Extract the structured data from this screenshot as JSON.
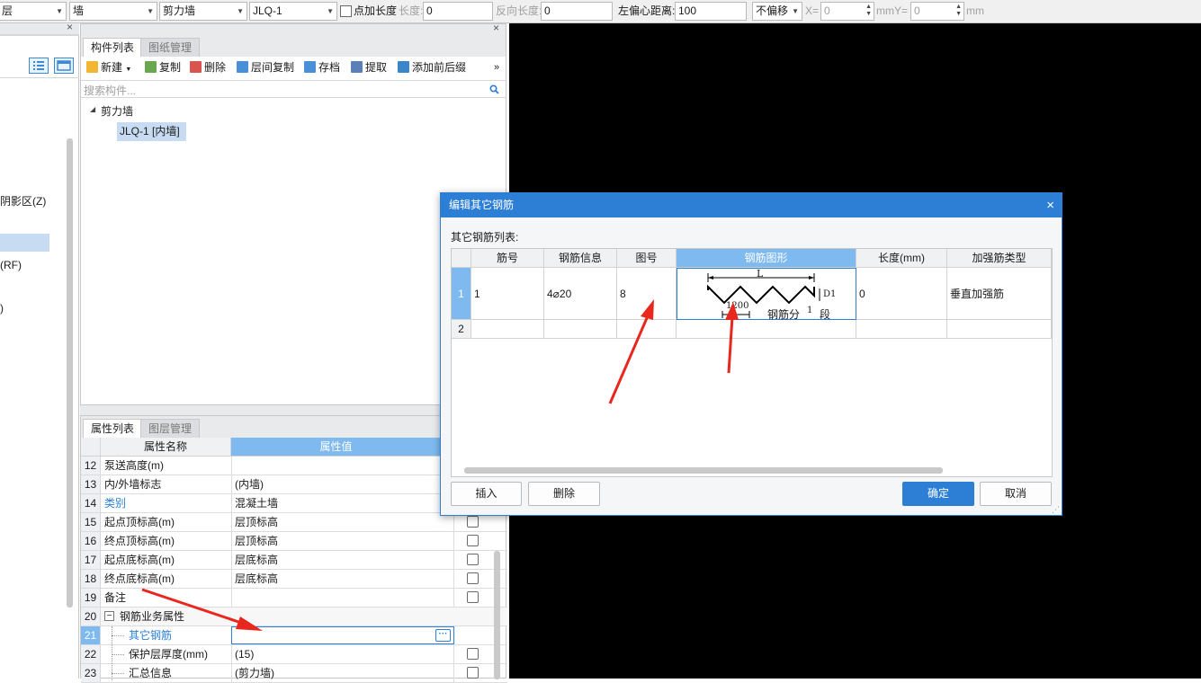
{
  "toolbar": {
    "combo1": "层",
    "combo2": "墙",
    "combo3": "剪力墙",
    "combo4": "JLQ-1",
    "checkbox_label": "点加长度",
    "length_label": "长度:",
    "length_value": "0",
    "reverse_length_label": "反向长度:",
    "reverse_length_value": "0",
    "left_offset_label": "左偏心距离:",
    "left_offset_value": "100",
    "offset_mode": "不偏移",
    "x_label": "X=",
    "x_value": "0",
    "mm_y_label": "mmY=",
    "y_value": "0",
    "mm_label": "mm"
  },
  "left_panel": {
    "items": [
      "阴影区(Z)",
      "(RF)",
      ")"
    ]
  },
  "component_panel": {
    "tabs": [
      "构件列表",
      "图纸管理"
    ],
    "buttons": [
      "新建",
      "复制",
      "删除",
      "层间复制",
      "存档",
      "提取",
      "添加前后缀"
    ],
    "more": "»",
    "search_placeholder": "搜索构件...",
    "tree_root": "剪力墙",
    "tree_child": "JLQ-1 [内墙]",
    "close": "×"
  },
  "property_panel": {
    "tabs": [
      "属性列表",
      "图层管理"
    ],
    "header_name": "属性名称",
    "header_value": "属性值",
    "rows": [
      {
        "num": "12",
        "name": "泵送高度(m)",
        "value": ""
      },
      {
        "num": "13",
        "name": "内/外墙标志",
        "value": "(内墙)"
      },
      {
        "num": "14",
        "name": "类别",
        "value": "混凝土墙"
      },
      {
        "num": "15",
        "name": "起点顶标高(m)",
        "value": "层顶标高"
      },
      {
        "num": "16",
        "name": "终点顶标高(m)",
        "value": "层顶标高"
      },
      {
        "num": "17",
        "name": "起点底标高(m)",
        "value": "层底标高"
      },
      {
        "num": "18",
        "name": "终点底标高(m)",
        "value": "层底标高"
      },
      {
        "num": "19",
        "name": "备注",
        "value": ""
      },
      {
        "num": "20",
        "name": "钢筋业务属性",
        "value": ""
      },
      {
        "num": "21",
        "name": "其它钢筋",
        "value": ""
      },
      {
        "num": "22",
        "name": "保护层厚度(mm)",
        "value": "(15)"
      },
      {
        "num": "23",
        "name": "汇总信息",
        "value": "(剪力墙)"
      }
    ],
    "expand_symbol": "−",
    "ellipsis": "···"
  },
  "dialog": {
    "title": "编辑其它钢筋",
    "close": "×",
    "list_label": "其它钢筋列表:",
    "columns": [
      "筋号",
      "钢筋信息",
      "图号",
      "钢筋图形",
      "长度(mm)",
      "加强筋类型"
    ],
    "rows": [
      {
        "idx": "1",
        "bar_no": "1",
        "info": "4⌀20",
        "fig": "8",
        "length": "0",
        "type": "垂直加强筋"
      },
      {
        "idx": "2",
        "bar_no": "",
        "info": "",
        "fig": "",
        "length": "",
        "type": ""
      }
    ],
    "shape": {
      "L": "L",
      "D1": "D1",
      "spacing": "1200",
      "segments_label": "钢筋分",
      "segments_value": "1",
      "segments_unit": "段"
    },
    "buttons": {
      "insert": "插入",
      "delete": "删除",
      "ok": "确定",
      "cancel": "取消"
    }
  },
  "colors": {
    "accent": "#2d7fd6",
    "header_blue": "#7eb9ef",
    "arrow": "#e8271e",
    "canvas": "#000000"
  }
}
